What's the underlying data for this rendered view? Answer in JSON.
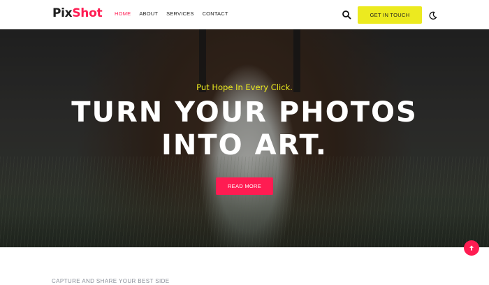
{
  "brand": {
    "part1": "Pix",
    "part2": "Shot"
  },
  "nav": {
    "items": [
      {
        "label": "HOME",
        "active": true
      },
      {
        "label": "ABOUT",
        "active": false
      },
      {
        "label": "SERVICES",
        "active": false
      },
      {
        "label": "CONTACT",
        "active": false
      }
    ]
  },
  "header": {
    "search_icon": "search-icon",
    "cta_label": "GET IN TOUCH",
    "theme_icon": "moon-icon"
  },
  "hero": {
    "tagline": "Put Hope In Every Click.",
    "headline_line1": "TURN YOUR PHOTOS",
    "headline_line2": "INTO ART.",
    "button_label": "READ MORE"
  },
  "scroll_top": {
    "icon": "arrow-up-icon"
  },
  "section": {
    "label": "CAPTURE AND SHARE YOUR BEST SIDE"
  },
  "colors": {
    "accent": "#ff1c52",
    "highlight": "#ecea1f",
    "text_dark": "#1f1f1f",
    "muted": "#8a8f99"
  }
}
